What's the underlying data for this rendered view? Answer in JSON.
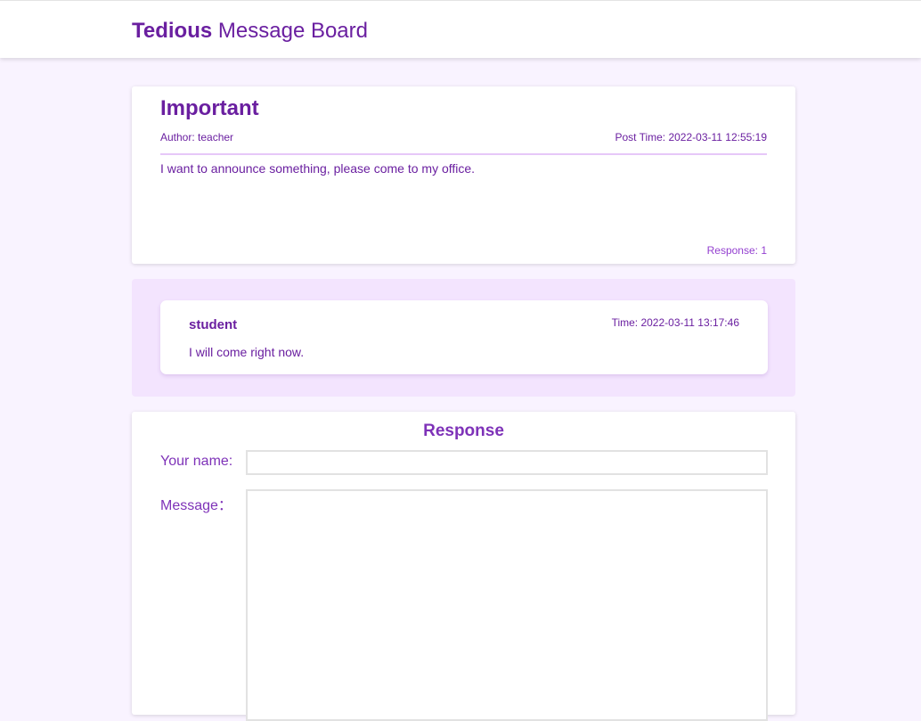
{
  "header": {
    "brand_bold": "Tedious",
    "brand_rest": " Message Board"
  },
  "post": {
    "title": "Important",
    "author": "Author: teacher",
    "post_time": "Post Time: 2022-03-11 12:55:19",
    "body": "I want to announce something, please come to my office.",
    "responses": "Response: 1"
  },
  "replies": [
    {
      "name": "student",
      "time": "Time: 2022-03-11 13:17:46",
      "text": "I will come right now."
    }
  ],
  "form": {
    "title": "Response",
    "name_label": "Your name:",
    "name_value": "",
    "message_label": "Message：",
    "message_value": ""
  },
  "colors": {
    "accent": "#6a1fa0",
    "page_background": "#f9f3ff",
    "reply_panel": "#f3e4fe"
  }
}
